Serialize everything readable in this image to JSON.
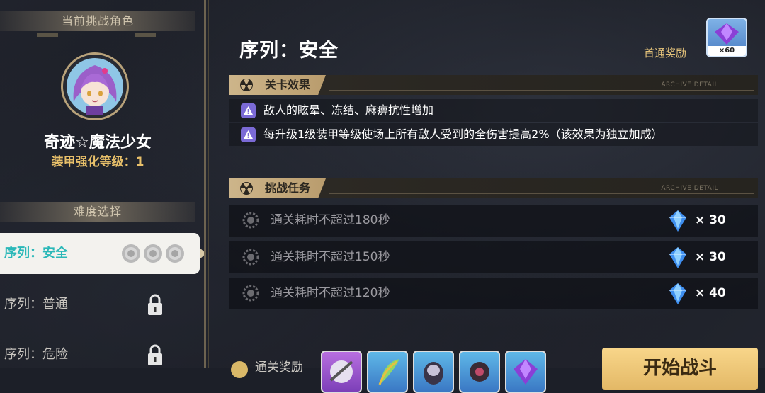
{
  "left_panel": {
    "challenge_header": "当前挑战角色",
    "character_name": "奇迹☆魔法少女",
    "armor_level": "装甲强化等级：1",
    "difficulty_header": "难度选择",
    "difficulties": [
      {
        "label": "序列：安全",
        "state": "selected",
        "medals": 3
      },
      {
        "label": "序列：普通",
        "state": "locked"
      },
      {
        "label": "序列：危险",
        "state": "locked"
      }
    ]
  },
  "main": {
    "sequence_title": "序列：安全",
    "first_clear_reward": {
      "label": "首通奖励",
      "count": "×60",
      "icon": "purple-crystal-icon"
    },
    "stage_effect": {
      "tab_label": "关卡效果",
      "archive_text": "ARCHIVE DETAIL",
      "effects": [
        "敌人的眩晕、冻结、麻痹抗性增加",
        "每升级1级装甲等级使场上所有敌人受到的全伤害提高2%（该效果为独立加成）"
      ]
    },
    "challenge_tasks": {
      "tab_label": "挑战任务",
      "archive_text": "ARCHIVE DETAIL",
      "tasks": [
        {
          "text": "通关耗时不超过180秒",
          "reward": "× 30"
        },
        {
          "text": "通关耗时不超过150秒",
          "reward": "× 30"
        },
        {
          "text": "通关耗时不超过120秒",
          "reward": "× 40"
        }
      ]
    },
    "bottom": {
      "reward_label": "通关奖励",
      "start_button": "开始战斗"
    }
  },
  "colors": {
    "accent_gold": "#e8c06a",
    "accent_teal": "#2bb8b8",
    "warning_purple": "#7b6ad6",
    "crystal_blue": "#3f8ff0"
  }
}
